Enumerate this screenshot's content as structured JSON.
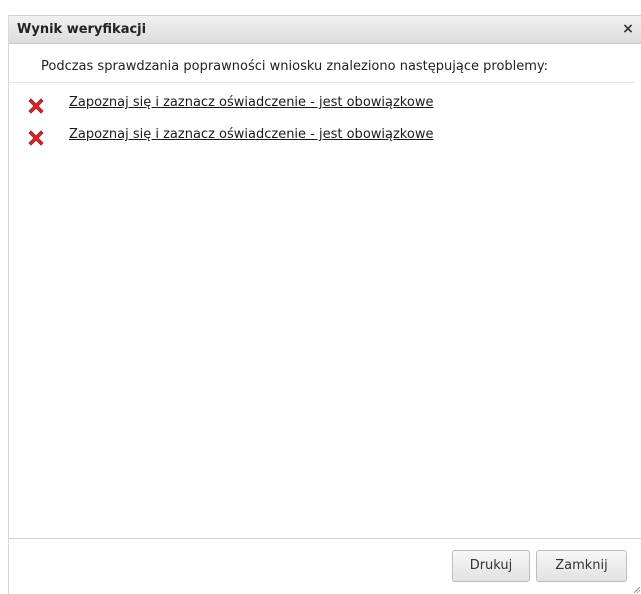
{
  "dialog": {
    "title": "Wynik weryfikacji",
    "close_glyph": "×",
    "intro": "Podczas sprawdzania poprawności wniosku znaleziono następujące problemy:",
    "problems": [
      {
        "icon": "error-x-icon",
        "text": "Zapoznaj się i zaznacz oświadczenie - jest obowiązkowe"
      },
      {
        "icon": "error-x-icon",
        "text": "Zapoznaj się i zaznacz oświadczenie - jest obowiązkowe"
      }
    ],
    "buttons": {
      "print_label": "Drukuj",
      "close_label": "Zamknij"
    }
  },
  "colors": {
    "error": "#d42a2a",
    "titlebar": "#e6e6e6"
  }
}
